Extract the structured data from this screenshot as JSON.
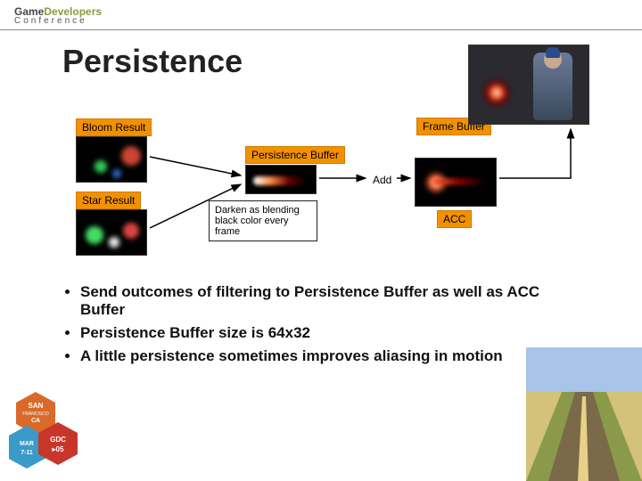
{
  "header": {
    "logo_game": "Game",
    "logo_dev": "Developers",
    "logo_conf": "Conference"
  },
  "title": "Persistence",
  "labels": {
    "bloom": "Bloom Result",
    "star": "Star Result",
    "persistence": "Persistence Buffer",
    "framebuffer": "Frame Buffer",
    "acc": "ACC",
    "add": "Add"
  },
  "note": "Darken as blending black color every frame",
  "bullets": [
    "Send outcomes of filtering to Persistence Buffer as well as ACC Buffer",
    "Persistence Buffer size is 64x32",
    "A little persistence sometimes improves aliasing in motion"
  ],
  "badge": {
    "city": "SAN FRANCISCO CA",
    "date": "MAR 7-11",
    "event": "GDC 05"
  }
}
